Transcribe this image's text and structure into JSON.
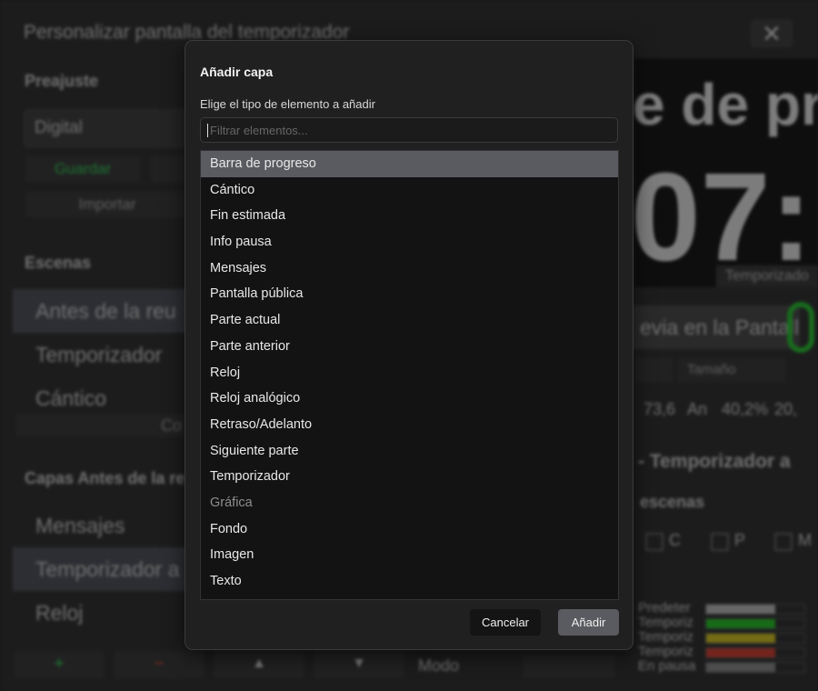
{
  "background": {
    "window_title": "Personalizar pantalla del temporizador",
    "preset_heading": "Preajuste",
    "preset_value": "Digital",
    "save_label": "Guardar",
    "import_label": "Importar",
    "scenes_heading": "Escenas",
    "scenes": [
      "Antes de la reu",
      "Temporizador",
      "Cántico"
    ],
    "scene_overlap_label": "Co",
    "layers_heading": "Capas Antes de la re",
    "layers": [
      "Mensajes",
      "Temporizador a",
      "Reloj"
    ],
    "preview_line1": "e de pr",
    "preview_line2": "07:",
    "preview_label": "Temporizado",
    "preview_button": "evia en la Pantalla",
    "size_label": "Tamaño",
    "val_x": "73,6",
    "val_an": "An",
    "val_w": "40,2%",
    "val_y": "20,",
    "layer_title": "- Temporizador a",
    "scenes_sub": "escenas",
    "chk_labels": [
      "C",
      "P",
      "M"
    ],
    "bottom_label": "Modo",
    "color_labels": [
      "Predeter",
      "Temporiz",
      "Temporiz",
      "Temporiz",
      "En pausa"
    ],
    "toolbar": {
      "add": "+",
      "remove": "−",
      "up": "▲",
      "down": "▼"
    },
    "close_glyph": "✕"
  },
  "dialog": {
    "title": "Añadir capa",
    "subtitle": "Elige el tipo de elemento a añadir",
    "filter_placeholder": "Filtrar elementos...",
    "items": [
      "Barra de progreso",
      "Cántico",
      "Fin estimada",
      "Info pausa",
      "Mensajes",
      "Pantalla pública",
      "Parte actual",
      "Parte anterior",
      "Reloj",
      "Reloj analógico",
      "Retraso/Adelanto",
      "Siguiente parte",
      "Temporizador",
      "Gráfica",
      "Fondo",
      "Imagen",
      "Texto"
    ],
    "selected_item": "Barra de progreso",
    "disabled_item": "Gráfica",
    "cancel_label": "Cancelar",
    "add_label": "Añadir"
  },
  "colors": {
    "accent_green": "#22c22a",
    "bar_green": "#1fc41f",
    "bar_yellow": "#d6c51a",
    "bar_red": "#d23a2a",
    "selection": "#5a5b60"
  }
}
